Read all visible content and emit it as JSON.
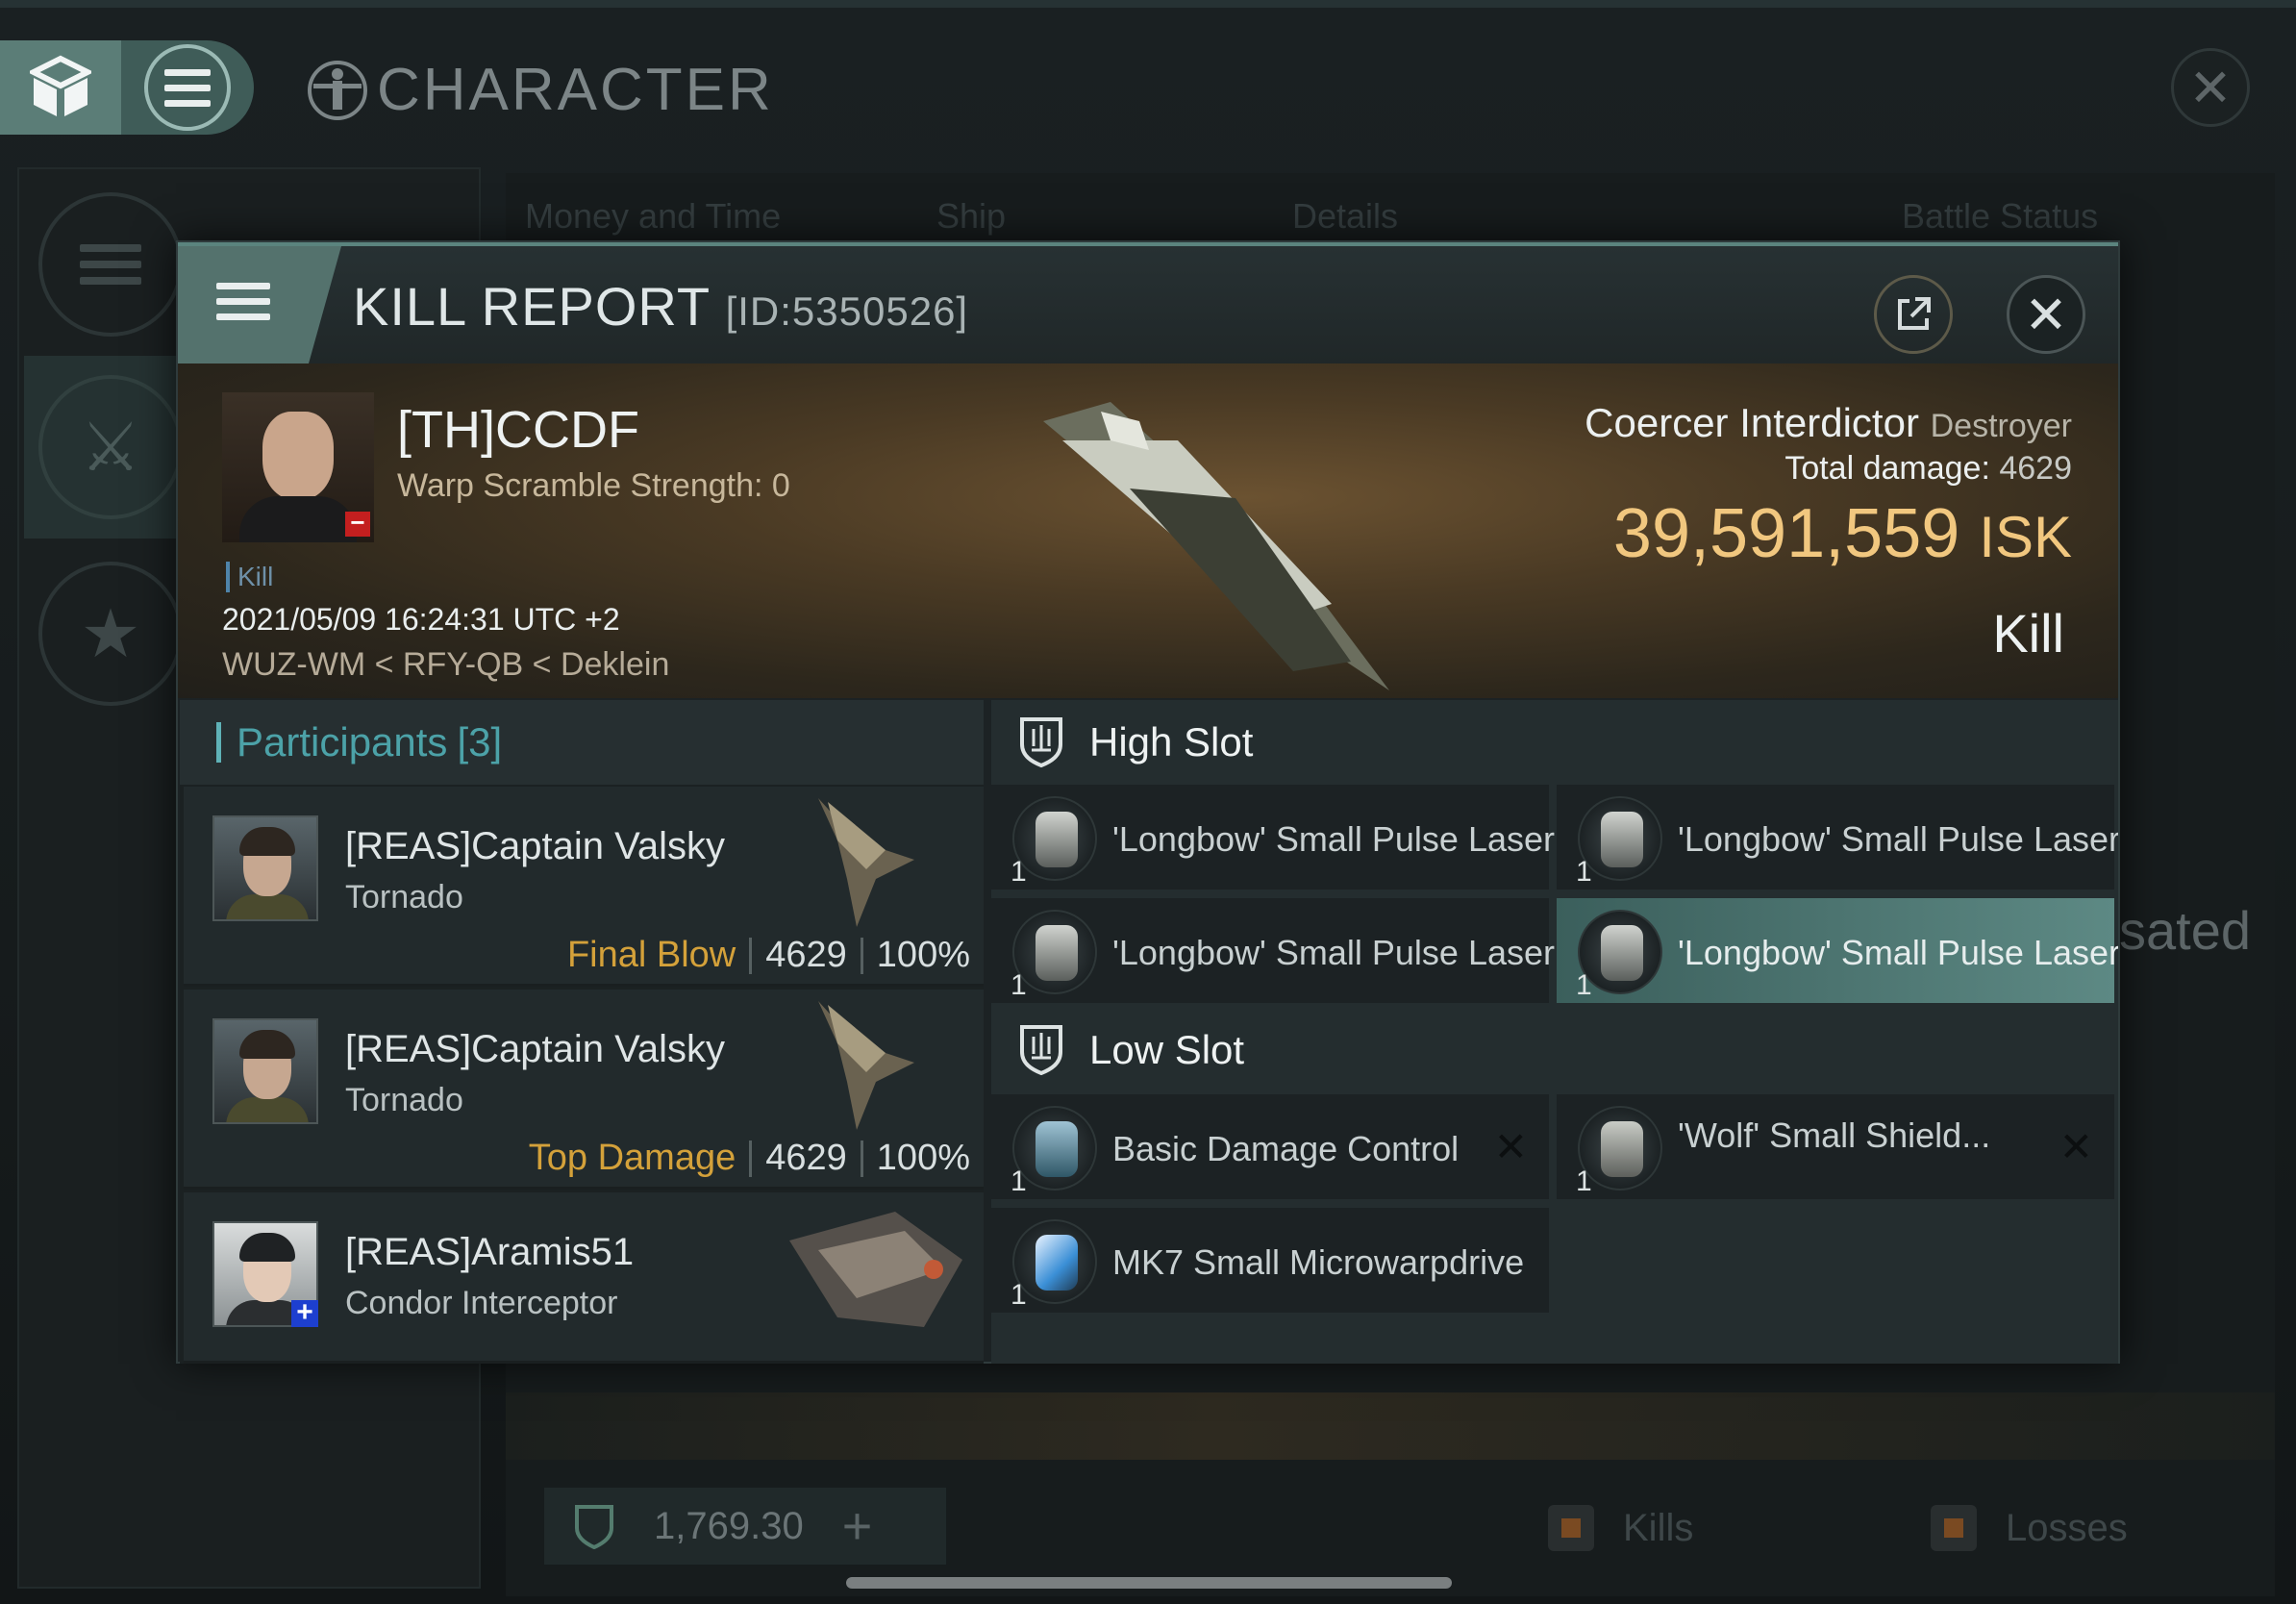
{
  "background": {
    "window_title": "CHARACTER",
    "columns": [
      "Money and Time",
      "Ship",
      "Details",
      "Battle Status"
    ],
    "side_text": "sated",
    "footer_value": "1,769.30",
    "legend": [
      "Kills",
      "Losses"
    ]
  },
  "modal": {
    "title": "KILL REPORT",
    "report_id": "[ID:5350526]",
    "victim": {
      "name": "[TH]CCDF",
      "warp_scramble": "Warp Scramble Strength: 0",
      "tag": "Kill",
      "datetime": "2021/05/09 16:24:31 UTC +2",
      "location": "WUZ-WM < RFY-QB < Deklein",
      "ship_name": "Coercer Interdictor",
      "ship_class": "Destroyer",
      "total_damage_label": "Total damage:",
      "total_damage": "4629",
      "isk_value": "39,591,559",
      "isk_unit": "ISK",
      "result": "Kill"
    },
    "participants": {
      "label": "Participants",
      "count": "[3]",
      "items": [
        {
          "name": "[REAS]Captain Valsky",
          "ship": "Tornado",
          "role": "Final Blow",
          "damage": "4629",
          "percent": "100%"
        },
        {
          "name": "[REAS]Captain Valsky",
          "ship": "Tornado",
          "role": "Top Damage",
          "damage": "4629",
          "percent": "100%"
        },
        {
          "name": "[REAS]Aramis51",
          "ship": "Condor Interceptor"
        }
      ]
    },
    "fitting": {
      "high_slot": {
        "label": "High Slot",
        "modules": [
          {
            "qty": "1",
            "name": "'Longbow' Small Pulse Laser"
          },
          {
            "qty": "1",
            "name": "'Longbow' Small Pulse Laser"
          },
          {
            "qty": "1",
            "name": "'Longbow' Small Pulse Laser"
          },
          {
            "qty": "1",
            "name": "'Longbow' Small Pulse Laser"
          }
        ]
      },
      "low_slot": {
        "label": "Low Slot",
        "modules": [
          {
            "qty": "1",
            "name": "Basic Damage Control"
          },
          {
            "qty": "1",
            "name": "'Wolf' Small Shield..."
          },
          {
            "qty": "1",
            "name": "MK7 Small Microwarpdrive"
          }
        ]
      }
    }
  }
}
